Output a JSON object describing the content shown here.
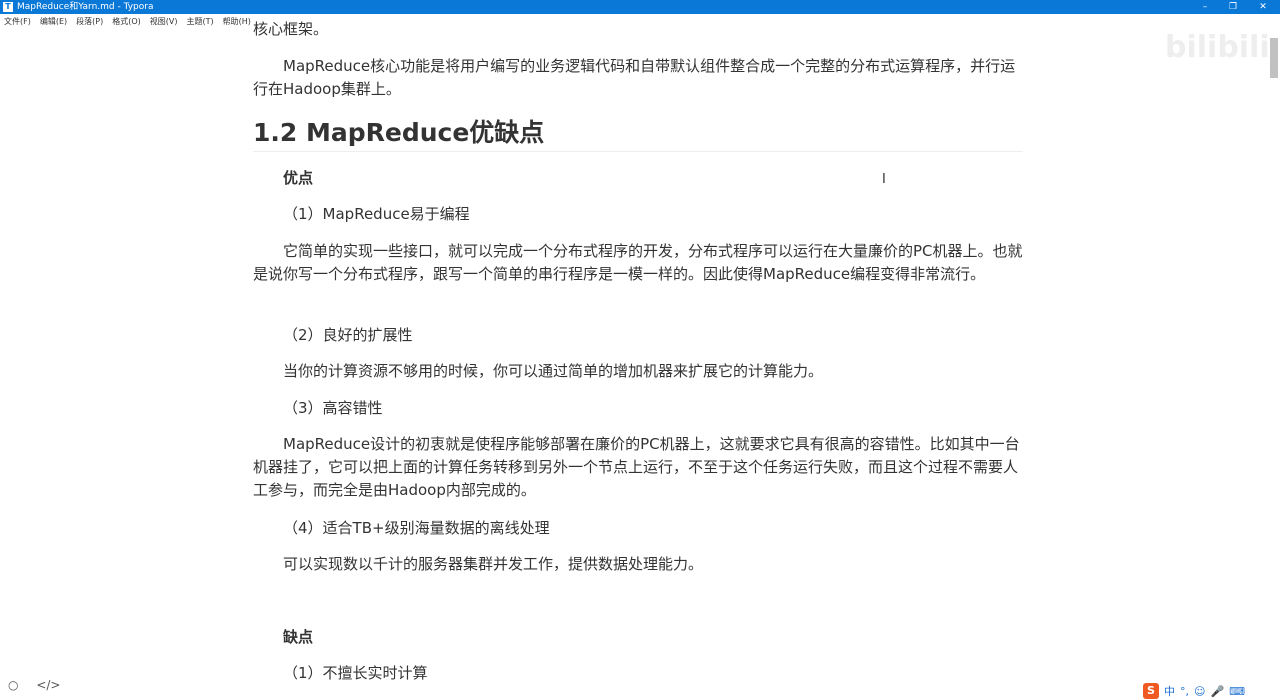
{
  "window": {
    "title": "MapReduce和Yarn.md - Typora",
    "app_icon": "T",
    "minimize": "–",
    "restore": "❐",
    "close": "✕"
  },
  "menu": [
    "文件(F)",
    "编辑(E)",
    "段落(P)",
    "格式(O)",
    "视图(V)",
    "主题(T)",
    "帮助(H)"
  ],
  "doc": {
    "top_fragment": "核心框架。",
    "intro": "MapReduce核心功能是将用户编写的业务逻辑代码和自带默认组件整合成一个完整的分布式运算程序，并行运行在Hadoop集群上。",
    "heading": "1.2 MapReduce优缺点",
    "pros_title": "优点",
    "p1_title": "（1）MapReduce易于编程",
    "p1_body": "它简单的实现一些接口，就可以完成一个分布式程序的开发，分布式程序可以运行在大量廉价的PC机器上。也就是说你写一个分布式程序，跟写一个简单的串行程序是一模一样的。因此使得MapReduce编程变得非常流行。",
    "p2_title": "（2）良好的扩展性",
    "p2_body": "当你的计算资源不够用的时候，你可以通过简单的增加机器来扩展它的计算能力。",
    "p3_title": "（3）高容错性",
    "p3_body": "MapReduce设计的初衷就是使程序能够部署在廉价的PC机器上，这就要求它具有很高的容错性。比如其中一台机器挂了，它可以把上面的计算任务转移到另外一个节点上运行，不至于这个任务运行失败，而且这个过程不需要人工参与，而完全是由Hadoop内部完成的。",
    "p4_title": "（4）适合TB+级别海量数据的离线处理",
    "p4_body": "可以实现数以千计的服务器集群并发工作，提供数据处理能力。",
    "cons_title": "缺点",
    "c1_title": "（1）不擅长实时计算"
  },
  "watermark": "bilibili",
  "statusbar": {
    "circle": "○",
    "code": "</>"
  },
  "ime": {
    "logo": "S",
    "mode": "中",
    "punct": "°,",
    "emoji": "☺",
    "mic": "🎤",
    "kb": "⌨"
  }
}
